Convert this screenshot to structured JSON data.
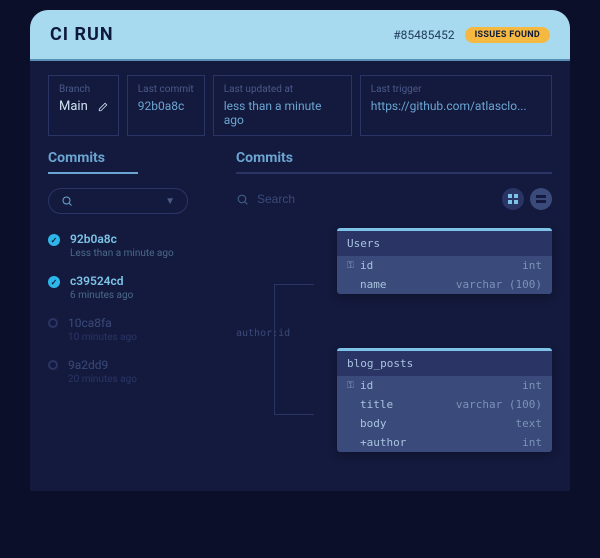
{
  "header": {
    "title": "CI RUN",
    "run_id": "#85485452",
    "badge": "ISSUES FOUND"
  },
  "meta": {
    "branch_label": "Branch",
    "branch_value": "Main",
    "last_commit_label": "Last commit",
    "last_commit_value": "92b0a8c",
    "updated_label": "Last updated at",
    "updated_value": "less than a minute ago",
    "trigger_label": "Last trigger",
    "trigger_value": "https://github.com/atlasclo..."
  },
  "left": {
    "title": "Commits",
    "search_icon": "search-icon"
  },
  "commits": [
    {
      "hash": "92b0a8c",
      "time": "Less than a minute ago",
      "state": "done",
      "current": true
    },
    {
      "hash": "c39524cd",
      "time": "6 minutes ago",
      "state": "done",
      "current": true
    },
    {
      "hash": "10ca8fa",
      "time": "10 minutes ago",
      "state": "pending",
      "current": false
    },
    {
      "hash": "9a2dd9",
      "time": "20 minutes ago",
      "state": "pending",
      "current": false
    }
  ],
  "right": {
    "title": "Commits",
    "search_placeholder": "Search"
  },
  "erd": {
    "edge_label": "author:id",
    "tables": {
      "users": {
        "name": "Users",
        "cols": [
          {
            "key": true,
            "name": "id",
            "type": "int"
          },
          {
            "key": false,
            "name": "name",
            "type": "varchar (100)"
          }
        ]
      },
      "blog_posts": {
        "name": "blog_posts",
        "cols": [
          {
            "key": true,
            "name": "id",
            "type": "int"
          },
          {
            "key": false,
            "name": "title",
            "type": "varchar (100)"
          },
          {
            "key": false,
            "name": "body",
            "type": "text"
          },
          {
            "key": false,
            "name": "+author",
            "type": "int"
          }
        ]
      }
    }
  }
}
